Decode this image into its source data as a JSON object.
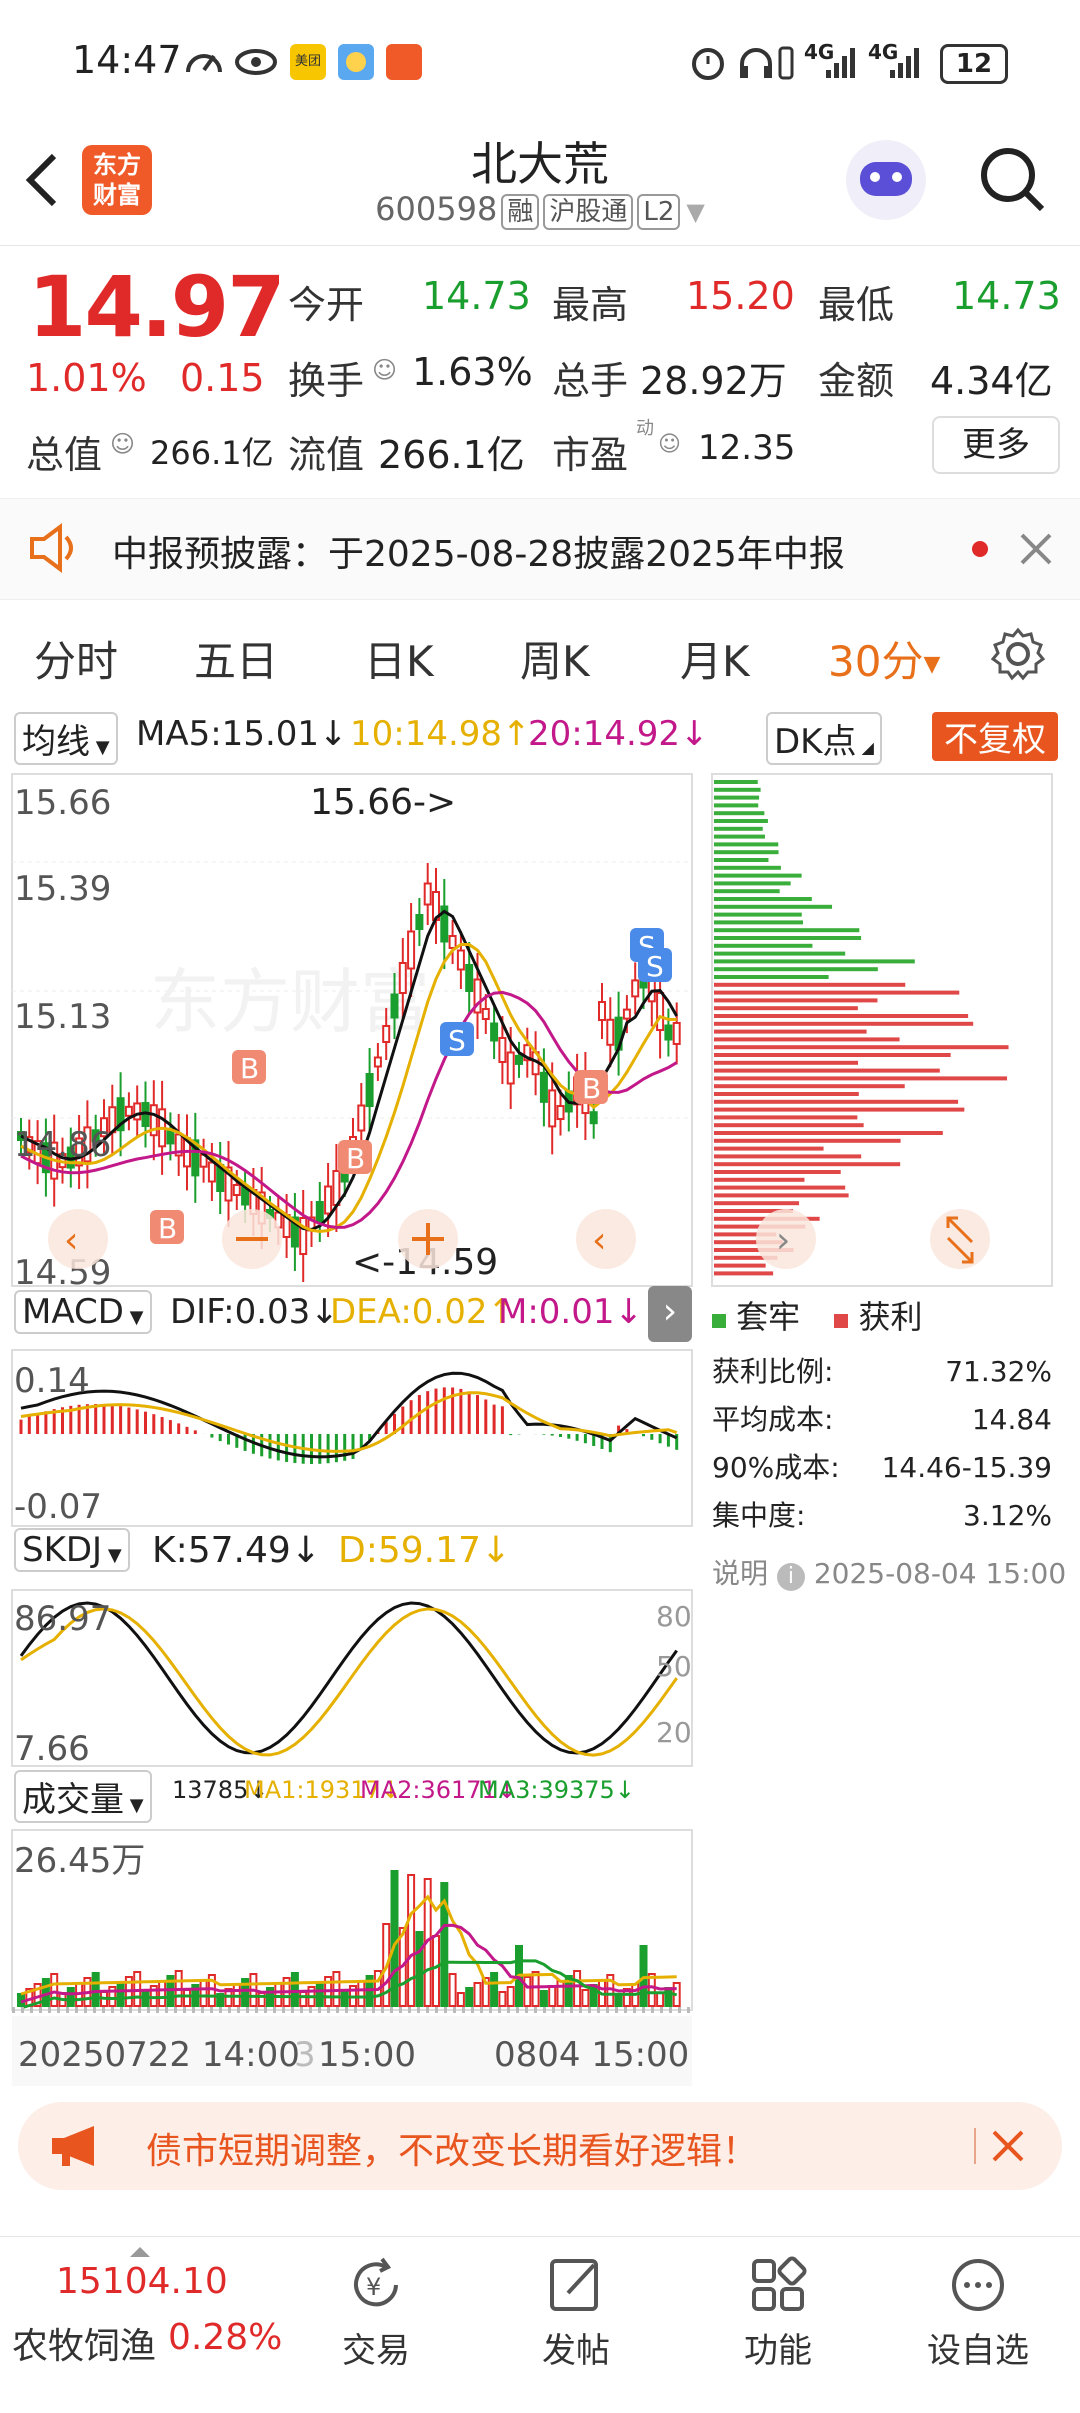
{
  "status_bar": {
    "time": "14:47",
    "battery": "12",
    "net1": "4G",
    "net2": "4G",
    "app_badge": "美团"
  },
  "header": {
    "logo_line1": "东方",
    "logo_line2": "财富",
    "stock_name": "北大荒",
    "stock_code": "600598",
    "tags": [
      "融",
      "沪股通",
      "L2"
    ]
  },
  "quote": {
    "price": "14.97",
    "change_pct": "1.01%",
    "change": "0.15",
    "open_label": "今开",
    "open": "14.73",
    "high_label": "最高",
    "high": "15.20",
    "low_label": "最低",
    "low": "14.73",
    "turnover_label": "换手",
    "turnover": "1.63%",
    "volume_label": "总手",
    "volume": "28.92万",
    "amount_label": "金额",
    "amount": "4.34亿",
    "mktcap_label": "总值",
    "mktcap": "266.1亿",
    "float_label": "流值",
    "float": "266.1亿",
    "pe_label": "市盈",
    "pe_sup": "动",
    "pe": "12.35",
    "more": "更多"
  },
  "notice": {
    "text": "中报预披露：于2025-08-28披露2025年中报"
  },
  "tabs": {
    "items": [
      "分时",
      "五日",
      "日K",
      "周K",
      "月K"
    ],
    "active": "30分"
  },
  "ma_row": {
    "selector": "均线",
    "ma5": "MA5:15.01",
    "ma10": "10:14.98",
    "ma20": "20:14.92",
    "dk": "DK点",
    "fq": "不复权"
  },
  "kline": {
    "y_labels": [
      "15.66",
      "15.39",
      "15.13",
      "14.86",
      "14.59"
    ],
    "high_tag": "15.66->",
    "low_tag": "<-14.59",
    "watermark": "东方财富",
    "marks_b": [
      "B",
      "B",
      "B",
      "B"
    ],
    "marks_s": [
      "S",
      "S",
      "S"
    ]
  },
  "macd": {
    "selector": "MACD",
    "dif": "DIF:0.03",
    "dea": "DEA:0.02",
    "m": "M:0.01",
    "y_top": "0.14",
    "y_bottom": "-0.07"
  },
  "skdj": {
    "selector": "SKDJ",
    "k": "K:57.49",
    "d": "D:59.17",
    "y_top": "86.97",
    "y_bottom": "7.66",
    "r80": "80",
    "r50": "50",
    "r20": "20"
  },
  "vol": {
    "selector": "成交量",
    "v": "13785",
    "ma1": "MA1:19317",
    "ma2": "MA2:36171",
    "ma3": "MA3:39375",
    "y_top": "26.45万",
    "x_left": "20250722 14:00",
    "x_mid": "15:00",
    "x_right": "0804 15:00",
    "x_mid_prefix": "3"
  },
  "chip": {
    "legend_trap": "套牢",
    "legend_profit": "获利",
    "rows": [
      {
        "label": "获利比例:",
        "value": "71.32%"
      },
      {
        "label": "平均成本:",
        "value": "14.84"
      },
      {
        "label": "90%成本:",
        "value": "14.46-15.39"
      },
      {
        "label": "集中度:",
        "value": "3.12%"
      }
    ],
    "note_label": "说明",
    "note_time": "2025-08-04 15:00"
  },
  "ad": {
    "text": "债市短期调整，不改变长期看好逻辑！"
  },
  "bottom": {
    "index_value": "15104.10",
    "index_name": "农牧饲渔",
    "index_pct": "0.28%",
    "nav": [
      "交易",
      "发帖",
      "功能",
      "设自选"
    ]
  },
  "colors": {
    "up": "#e02a2a",
    "down": "#1a9e2d",
    "accent": "#e8701a",
    "ma10": "#e5b000",
    "ma20": "#c2188a"
  }
}
